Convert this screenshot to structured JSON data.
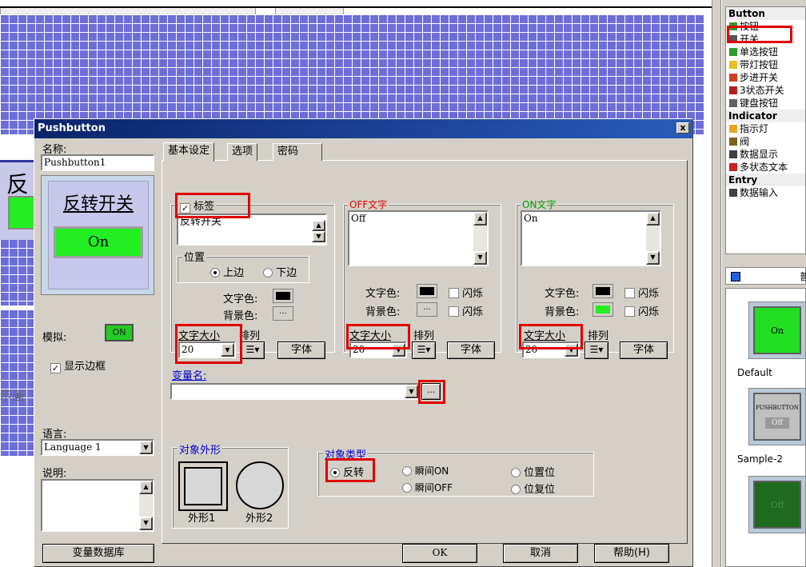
{
  "background_canvas": {
    "left_char": "反",
    "side_text": "示画"
  },
  "right_panel": {
    "categories": [
      {
        "header": "Button",
        "items": [
          {
            "label": "按钮",
            "icon": "green-rect-icon",
            "color": "#2c9a2c"
          },
          {
            "label": "开关",
            "icon": "switch-icon",
            "color": "#555555"
          },
          {
            "label": "单选按钮",
            "icon": "radio-group-icon",
            "color": "#2c9a2c"
          },
          {
            "label": "带灯按钮",
            "icon": "lamp-button-icon",
            "color": "#e8c020"
          },
          {
            "label": "步进开关",
            "icon": "step-switch-icon",
            "color": "#d04020"
          },
          {
            "label": "3状态开关",
            "icon": "tri-state-icon",
            "color": "#b02020"
          },
          {
            "label": "键盘按钮",
            "icon": "key-button-icon",
            "color": "#606060"
          }
        ]
      },
      {
        "header": "Indicator",
        "items": [
          {
            "label": "指示灯",
            "icon": "lamp-icon",
            "color": "#f0a020"
          },
          {
            "label": "阀",
            "icon": "valve-icon",
            "color": "#806020"
          },
          {
            "label": "数据显示",
            "icon": "data-display-icon",
            "color": "#404040"
          },
          {
            "label": "多状态文本",
            "icon": "multi-state-icon",
            "color": "#d02020"
          }
        ]
      },
      {
        "header": "Entry",
        "items": [
          {
            "label": "数据输入",
            "icon": "data-entry-icon",
            "color": "#404040"
          }
        ]
      }
    ],
    "gallery": [
      {
        "label": "Default",
        "preview_text": "On",
        "color": "#22dd22"
      },
      {
        "label": "Sample-2",
        "preview_text": "PUSHBUTTON",
        "preview_sub": "Off",
        "color": "#c0c0c0"
      },
      {
        "label": "",
        "preview_text": "Off",
        "color": "#1e6a1e"
      }
    ],
    "gallery_header_char": "普"
  },
  "dialog": {
    "title": "Pushbutton",
    "close": "x",
    "name_label": "名称:",
    "name_value": "Pushbutton1",
    "preview": {
      "label_text": "反转开关",
      "button_text": "On",
      "button_color": "#22ee22"
    },
    "simulate_label": "模拟:",
    "simulate_value": "ON",
    "show_border_label": "显示边框",
    "language_label": "语言:",
    "language_value": "Language 1",
    "description_label": "说明:",
    "var_db_button": "变量数据库",
    "tabs": [
      "基本设定",
      "选项",
      "密码"
    ],
    "label_section": {
      "checkbox_label": "标签",
      "text": "反转开关",
      "position_label": "位置",
      "pos_top": "上边",
      "pos_bottom": "下边",
      "text_color_label": "文字色:",
      "bg_color_label": "背景色:",
      "font_size_label": "文字大小",
      "align_label": "排列",
      "font_size_value": "20",
      "font_button": "字体",
      "text_color": "#000000"
    },
    "off_section": {
      "title": "OFF文字",
      "text": "Off",
      "text_color_label": "文字色:",
      "bg_color_label": "背景色:",
      "blink_label": "闪烁",
      "font_size_label": "文字大小",
      "align_label": "排列",
      "font_size_value": "20",
      "font_button": "字体",
      "text_color": "#000000",
      "bg_color": "#d4d0c8"
    },
    "on_section": {
      "title": "ON文字",
      "text": "On",
      "text_color_label": "文字色:",
      "bg_color_label": "背景色:",
      "blink_label": "闪烁",
      "font_size_label": "文字大小",
      "align_label": "排列",
      "font_size_value": "20",
      "font_button": "字体",
      "text_color": "#000000",
      "bg_color": "#22ee22"
    },
    "variable_label": "变量名:",
    "variable_value": "",
    "browse": "...",
    "shape_group": {
      "title": "对象外形",
      "shape1": "外形1",
      "shape2": "外形2"
    },
    "type_group": {
      "title": "对象类型",
      "options": [
        "反转",
        "瞬间ON",
        "位置位",
        "瞬间OFF",
        "位复位"
      ]
    },
    "ok": "OK",
    "cancel": "取消",
    "help": "帮助(H)"
  }
}
